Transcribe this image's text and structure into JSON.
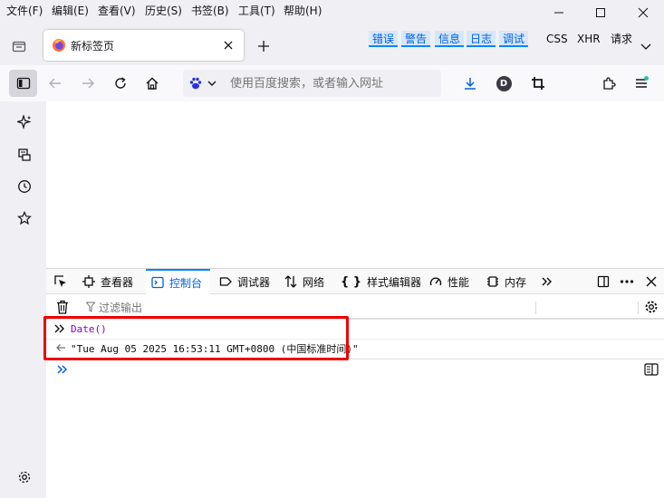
{
  "menubar": {
    "items": [
      "文件(F)",
      "编辑(E)",
      "查看(V)",
      "历史(S)",
      "书签(B)",
      "工具(T)",
      "帮助(H)"
    ]
  },
  "tab": {
    "title": "新标签页"
  },
  "urlbar": {
    "placeholder": "使用百度搜索，或者输入网址"
  },
  "account": {
    "initial": "D"
  },
  "devtools": {
    "tabs": [
      "查看器",
      "控制台",
      "调试器",
      "网络",
      "样式编辑器",
      "性能",
      "内存"
    ],
    "selected_tab": "控制台",
    "filter_placeholder": "过滤输出",
    "levels": [
      "错误",
      "警告",
      "信息",
      "日志",
      "调试"
    ],
    "extras": [
      "CSS",
      "XHR",
      "请求"
    ],
    "console": {
      "input": "Date()",
      "output": "\"Tue Aug 05 2025 16:53:11 GMT+0800 (中国标准时间)\""
    }
  },
  "colors": {
    "accent": "#0060df",
    "highlight": "#ee0000"
  }
}
